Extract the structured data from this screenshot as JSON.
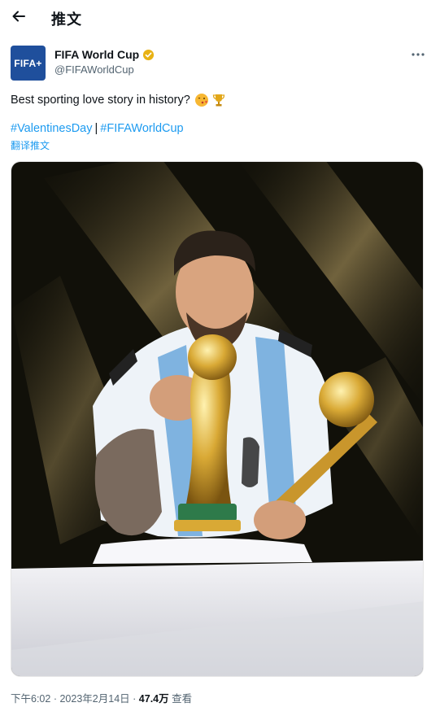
{
  "header": {
    "title": "推文",
    "back_icon": "arrow-left-icon"
  },
  "author": {
    "display_name": "FIFA World Cup",
    "handle": "@FIFAWorldCup",
    "avatar_text": "FIFA+",
    "verified_icon": "gold-verified-badge-icon",
    "verified_color": "#e8b214",
    "avatar_color": "#1f4f9c"
  },
  "tweet": {
    "text": "Best sporting love story in history?",
    "emojis": [
      "kissing-face-emoji",
      "trophy-emoji"
    ],
    "hashtags": [
      "#ValentinesDay",
      "#FIFAWorldCup"
    ],
    "separator": "|",
    "translate_label": "翻译推文",
    "link_color": "#1d9bf0"
  },
  "media": {
    "alt": "player kissing the world cup trophy while holding golden ball award"
  },
  "meta": {
    "time": "下午6:02",
    "date": "2023年2月14日",
    "views_count": "47.4万",
    "views_label": "查看",
    "dot": "·"
  }
}
